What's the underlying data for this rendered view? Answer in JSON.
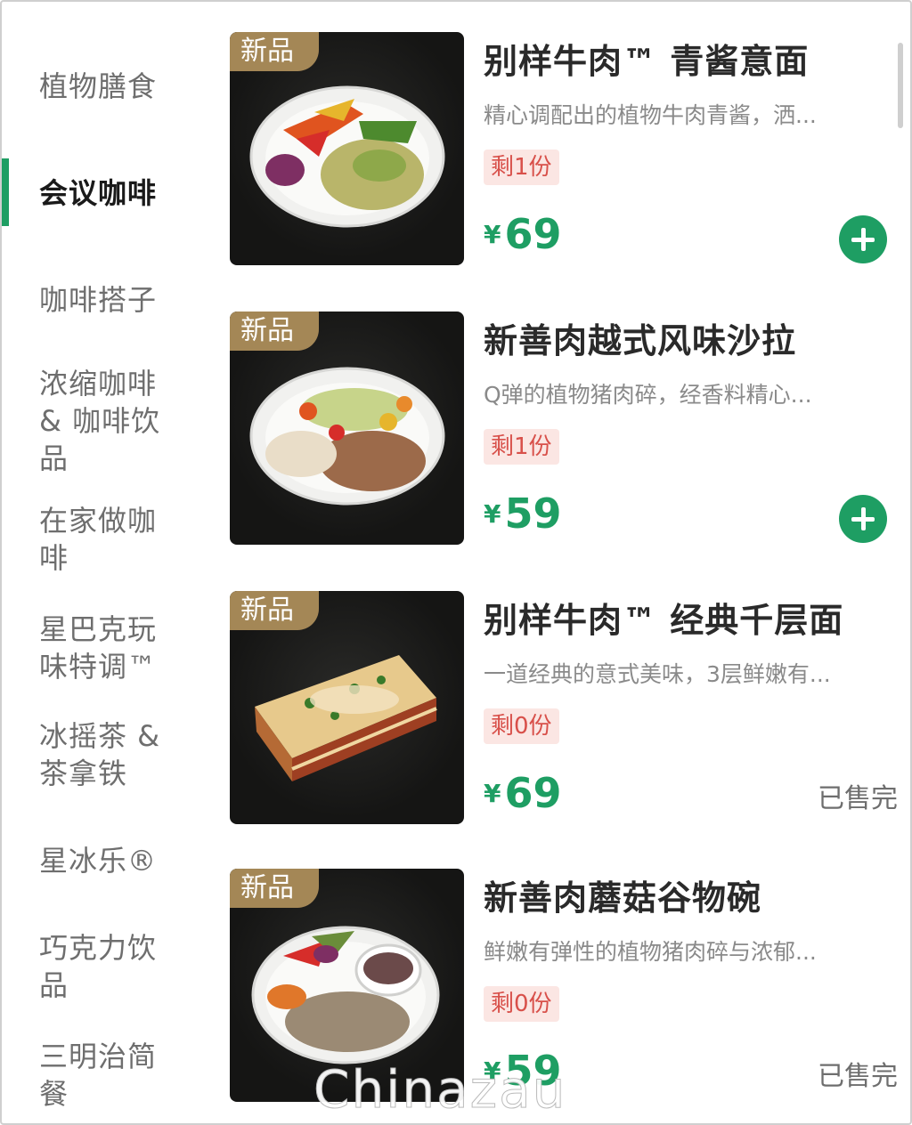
{
  "sidebar": {
    "categories": [
      {
        "label": "植物膳食"
      },
      {
        "label": "会议咖啡"
      },
      {
        "label": "咖啡搭子"
      },
      {
        "label": "浓缩咖啡 & 咖啡饮品"
      },
      {
        "label": "在家做咖啡"
      },
      {
        "label": "星巴克玩味特调™"
      },
      {
        "label": "冰摇茶 & 茶拿铁"
      },
      {
        "label": "星冰乐®"
      },
      {
        "label": "巧克力饮品"
      },
      {
        "label": "三明治简餐"
      }
    ],
    "active_index": 1
  },
  "products": [
    {
      "badge": "新品",
      "title": "别样牛肉™ 青酱意面",
      "desc": "精心调配出的植物牛肉青酱，洒...",
      "stock": "剩1份",
      "currency": "¥",
      "price": "69",
      "sold_out": false,
      "image_icon": "pesto-pasta-plate"
    },
    {
      "badge": "新品",
      "title": "新善肉越式风味沙拉",
      "desc": "Q弹的植物猪肉碎，经香料精心...",
      "stock": "剩1份",
      "currency": "¥",
      "price": "59",
      "sold_out": false,
      "image_icon": "vietnamese-salad-plate"
    },
    {
      "badge": "新品",
      "title": "别样牛肉™ 经典千层面",
      "desc": "一道经典的意式美味，3层鲜嫩有...",
      "stock": "剩0份",
      "currency": "¥",
      "price": "69",
      "sold_out": true,
      "sold_out_label": "已售完",
      "image_icon": "lasagna"
    },
    {
      "badge": "新品",
      "title": "新善肉蘑菇谷物碗",
      "desc": "鲜嫩有弹性的植物猪肉碎与浓郁...",
      "stock": "剩0份",
      "currency": "¥",
      "price": "59",
      "sold_out": true,
      "sold_out_label": "已售完",
      "image_icon": "mushroom-grain-bowl"
    }
  ],
  "watermark": "Chinazau",
  "colors": {
    "accent": "#1e9e63",
    "badge": "#a48756",
    "stock_bg": "#fbe6e3",
    "stock_text": "#d8504a"
  }
}
